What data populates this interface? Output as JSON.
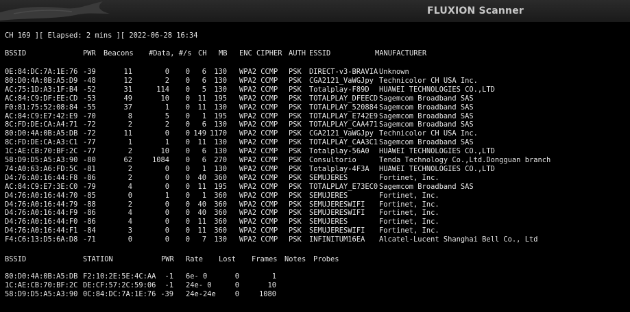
{
  "window": {
    "title": "FLUXION Scanner"
  },
  "status_line": "CH 169 ][ Elapsed: 2 mins ][ 2022-06-28 16:34",
  "ap_table": {
    "headers": [
      "BSSID",
      "PWR",
      "Beacons",
      "#Data, #/s",
      "CH",
      "MB",
      "ENC CIPHER",
      "AUTH",
      "ESSID",
      "MANUFACTURER"
    ],
    "rows": [
      [
        "0E:84:DC:7A:1E:76",
        "-39",
        "11",
        "0",
        "0",
        "6",
        "130",
        "WPA2 CCMP",
        "PSK",
        "DIRECT-v3-BRAVIA",
        "Unknown"
      ],
      [
        "80:D0:4A:0B:A5:D9",
        "-48",
        "12",
        "2",
        "0",
        "6",
        "130",
        "WPA2 CCMP",
        "PSK",
        "CGA2121_VaWGJpy",
        "Technicolor CH USA Inc."
      ],
      [
        "AC:75:1D:A3:1F:B4",
        "-52",
        "31",
        "114",
        "0",
        "5",
        "130",
        "WPA2 CCMP",
        "PSK",
        "Totalplay-F89D",
        "HUAWEI TECHNOLOGIES CO.,LTD"
      ],
      [
        "AC:84:C9:DF:EE:CD",
        "-53",
        "49",
        "10",
        "0",
        "11",
        "195",
        "WPA2 CCMP",
        "PSK",
        "TOTALPLAY_DFEECD",
        "Sagemcom Broadband SAS"
      ],
      [
        "F0:81:75:52:08:84",
        "-55",
        "37",
        "1",
        "0",
        "11",
        "130",
        "WPA2 CCMP",
        "PSK",
        "TOTALPLAY_520884",
        "Sagemcom Broadband SAS"
      ],
      [
        "AC:84:C9:E7:42:E9",
        "-70",
        "8",
        "5",
        "0",
        "1",
        "195",
        "WPA2 CCMP",
        "PSK",
        "TOTALPLAY_E742E9",
        "Sagemcom Broadband SAS"
      ],
      [
        "8C:FD:DE:CA:A4:71",
        "-72",
        "2",
        "2",
        "0",
        "6",
        "130",
        "WPA2 CCMP",
        "PSK",
        "TOTALPLAY_CAA471",
        "Sagemcom Broadband SAS"
      ],
      [
        "80:D0:4A:0B:A5:DB",
        "-72",
        "11",
        "0",
        "0",
        "149",
        "1170",
        "WPA2 CCMP",
        "PSK",
        "CGA2121_VaWGJpy",
        "Technicolor CH USA Inc."
      ],
      [
        "8C:FD:DE:CA:A3:C1",
        "-77",
        "1",
        "1",
        "0",
        "11",
        "130",
        "WPA2 CCMP",
        "PSK",
        "TOTALPLAY_CAA3C1",
        "Sagemcom Broadband SAS"
      ],
      [
        "1C:AE:CB:70:BF:2C",
        "-77",
        "2",
        "10",
        "0",
        "6",
        "130",
        "WPA2 CCMP",
        "PSK",
        "Totalplay-56A0",
        "HUAWEI TECHNOLOGIES CO.,LTD"
      ],
      [
        "58:D9:D5:A5:A3:90",
        "-80",
        "62",
        "1084",
        "0",
        "6",
        "270",
        "WPA2 CCMP",
        "PSK",
        "Consultorio",
        "Tenda Technology Co.,Ltd.Dongguan branch"
      ],
      [
        "74:A0:63:A6:FD:5C",
        "-81",
        "2",
        "0",
        "0",
        "1",
        "130",
        "WPA2 CCMP",
        "PSK",
        "Totalplay-4F3A",
        "HUAWEI TECHNOLOGIES CO.,LTD"
      ],
      [
        "D4:76:A0:16:44:F8",
        "-86",
        "2",
        "0",
        "0",
        "40",
        "360",
        "WPA2 CCMP",
        "PSK",
        "SEMUJERES",
        "Fortinet, Inc."
      ],
      [
        "AC:84:C9:E7:3E:C0",
        "-79",
        "4",
        "0",
        "0",
        "11",
        "195",
        "WPA2 CCMP",
        "PSK",
        "TOTALPLAY_E73EC0",
        "Sagemcom Broadband SAS"
      ],
      [
        "D4:76:A0:16:44:70",
        "-85",
        "0",
        "1",
        "0",
        "1",
        "360",
        "WPA2 CCMP",
        "PSK",
        "SEMUJERES",
        "Fortinet, Inc."
      ],
      [
        "D4:76:A0:16:44:79",
        "-88",
        "2",
        "0",
        "0",
        "40",
        "360",
        "WPA2 CCMP",
        "PSK",
        "SEMUJERESWIFI",
        "Fortinet, Inc."
      ],
      [
        "D4:76:A0:16:44:F9",
        "-86",
        "4",
        "0",
        "0",
        "40",
        "360",
        "WPA2 CCMP",
        "PSK",
        "SEMUJERESWIFI",
        "Fortinet, Inc."
      ],
      [
        "D4:76:A0:16:44:F0",
        "-86",
        "4",
        "0",
        "0",
        "11",
        "360",
        "WPA2 CCMP",
        "PSK",
        "SEMUJERES",
        "Fortinet, Inc."
      ],
      [
        "D4:76:A0:16:44:F1",
        "-84",
        "3",
        "0",
        "0",
        "11",
        "360",
        "WPA2 CCMP",
        "PSK",
        "SEMUJERESWIFI",
        "Fortinet, Inc."
      ],
      [
        "F4:C6:13:D5:6A:D8",
        "-71",
        "0",
        "0",
        "0",
        "7",
        "130",
        "WPA2 CCMP",
        "PSK",
        "INFINITUM16EA",
        "Alcatel-Lucent Shanghai Bell Co., Ltd"
      ]
    ]
  },
  "station_table": {
    "headers": [
      "BSSID",
      "STATION",
      "PWR",
      "Rate",
      "Lost",
      "Frames",
      "Notes",
      "Probes"
    ],
    "rows": [
      [
        "80:D0:4A:0B:A5:DB",
        "F2:10:2E:5E:4C:AA",
        "-1",
        "6e- 0",
        "0",
        "1"
      ],
      [
        "1C:AE:CB:70:BF:2C",
        "DE:CF:57:2C:59:06",
        "-1",
        "24e- 0",
        "0",
        "10"
      ],
      [
        "58:D9:D5:A5:A3:90",
        "0C:84:DC:7A:1E:76",
        "-39",
        "24e-24e",
        "0",
        "1080"
      ]
    ]
  }
}
